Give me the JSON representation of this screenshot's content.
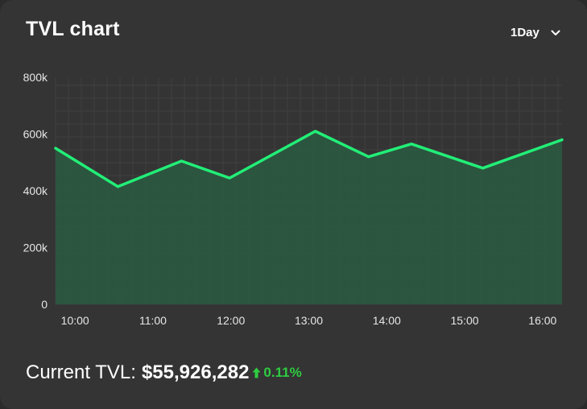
{
  "card": {
    "title": "TVL chart",
    "range_selector": {
      "selected": "1Day",
      "icon": "chevron-down-icon"
    }
  },
  "footer": {
    "label": "Current TVL:",
    "value": "$55,926,282",
    "change": "0.11%",
    "change_icon": "arrow-up-icon",
    "change_color": "#2ecc40"
  },
  "colors": {
    "line": "#22ee77",
    "area": "#2a5840",
    "grid": "#3f3f3f",
    "background": "#343434"
  },
  "chart_data": {
    "type": "area",
    "title": "TVL chart",
    "xlabel": "",
    "ylabel": "",
    "ylim": [
      0,
      800000
    ],
    "grid": true,
    "yticks": [
      {
        "value": 0,
        "label": "0"
      },
      {
        "value": 200000,
        "label": "200k"
      },
      {
        "value": 400000,
        "label": "400k"
      },
      {
        "value": 600000,
        "label": "600k"
      },
      {
        "value": 800000,
        "label": "800k"
      }
    ],
    "xticks": [
      "10:00",
      "11:00",
      "12:00",
      "13:00",
      "14:00",
      "15:00",
      "16:00"
    ],
    "xlim": [
      "09:45",
      "16:15"
    ],
    "series": [
      {
        "x": [
          "09:45",
          "10:33",
          "11:22",
          "11:59",
          "13:05",
          "13:46",
          "14:19",
          "15:14",
          "16:15"
        ],
        "y": [
          550000,
          415000,
          505000,
          445000,
          610000,
          520000,
          565000,
          480000,
          580000
        ]
      }
    ]
  }
}
